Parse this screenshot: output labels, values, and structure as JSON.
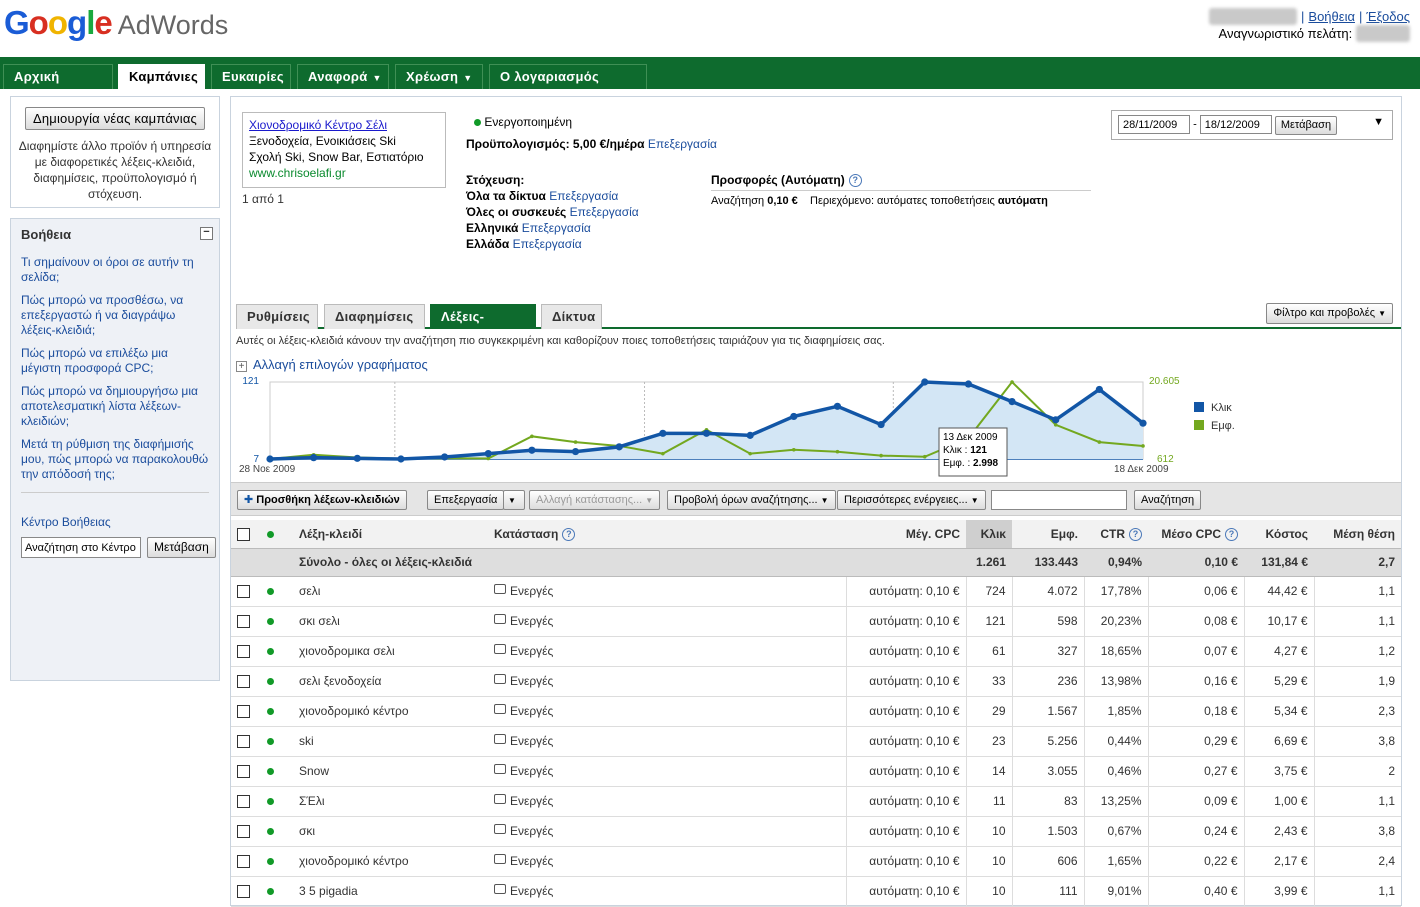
{
  "header": {
    "logo_word": "Google",
    "product": "AdWords",
    "email": "•••••••@••••••.gr",
    "help_link": "Βοήθεια",
    "logout_link": "Έξοδος",
    "customer_id_label": "Αναγνωριστικό πελάτη:",
    "customer_id": "•••-•••-••••"
  },
  "nav": {
    "tabs": [
      {
        "label": "Αρχική σελίδα"
      },
      {
        "label": "Καμπάνιες"
      },
      {
        "label": "Ευκαιρίες"
      },
      {
        "label": "Αναφορά"
      },
      {
        "label": "Χρέωση"
      },
      {
        "label": "Ο λογαριασμός μου"
      }
    ],
    "active_index": 1
  },
  "left": {
    "create_button": "Δημιουργία νέας καμπάνιας",
    "create_desc": "Διαφημίστε άλλο προϊόν ή υπηρεσία με διαφορετικές λέξεις-κλειδιά, διαφημίσεις, προϋπολογισμό ή στόχευση.",
    "help_title": "Βοήθεια",
    "help_links": [
      "Τι σημαίνουν οι όροι σε αυτήν τη σελίδα;",
      "Πώς μπορώ να προσθέσω, να επεξεργαστώ ή να διαγράψω λέξεις-κλειδιά;",
      "Πώς μπορώ να επιλέξω μια μέγιστη προσφορά CPC;",
      "Πώς μπορώ να δημιουργήσω μια αποτελεσματική λίστα λέξεων-κλειδιών;",
      "Μετά τη ρύθμιση της διαφήμισής μου, πώς μπορώ να παρακολουθώ την απόδοσή της;"
    ],
    "help_center": "Κέντρο Βοήθειας",
    "help_search_value": "Αναζήτηση στο Κέντρο Β",
    "help_search_button": "Μετάβαση"
  },
  "ad": {
    "title": "Χιονοδρομικό Κέντρο Σέλι",
    "line1": "Ξενοδοχεία, Ενοικιάσεις Ski",
    "line2": "Σχολή Ski, Snow Bar, Εστιατόριο",
    "url": "www.chrisoelafi.gr",
    "count": "1 από 1"
  },
  "campaign": {
    "status": "Ενεργοποιημένη",
    "budget_label": "Προϋπολογισμός:",
    "budget_value": "5,00 €/ημέρα",
    "edit": "Επεξεργασία",
    "targeting_label": "Στόχευση:",
    "targeting": [
      {
        "label": "Όλα τα δίκτυα"
      },
      {
        "label": "Όλες οι συσκευές"
      },
      {
        "label": "Ελληνικά"
      },
      {
        "label": "Ελλάδα"
      }
    ],
    "bids_label": "Προσφορές (Αυτόματη)",
    "search_label": "Αναζήτηση",
    "search_value": "0,10 €",
    "content_label": "Περιεχόμενο: αυτόματες τοποθετήσεις",
    "content_value": "αυτόματη"
  },
  "daterange": {
    "start": "28/11/2009",
    "dash": "-",
    "end": "18/12/2009",
    "go": "Μετάβαση"
  },
  "subtabs": [
    {
      "label": "Ρυθμίσεις"
    },
    {
      "label": "Διαφημίσεις"
    },
    {
      "label": "Λέξεις-κλειδιά"
    },
    {
      "label": "Δίκτυα"
    }
  ],
  "subtab_active": 2,
  "filter_button": "Φίλτρο και προβολές",
  "subtab_desc": "Αυτές οι λέξεις-κλειδιά κάνουν την αναζήτηση πιο συγκεκριμένη και καθορίζουν ποιες τοποθετήσεις ταιριάζουν για τις διαφημίσεις σας.",
  "chart_toggle": "Αλλαγή επιλογών γραφήματος",
  "chart_data": {
    "type": "line",
    "x_start_label": "28 Νοε 2009",
    "x_end_label": "18 Δεκ 2009",
    "series": [
      {
        "name": "Κλικ",
        "color": "#1256a6",
        "axis": "left",
        "values": [
          7,
          9,
          8,
          7,
          10,
          15,
          20,
          18,
          25,
          45,
          45,
          42,
          70,
          85,
          58,
          121,
          118,
          92,
          65,
          110,
          60
        ]
      },
      {
        "name": "Εμφ.",
        "color": "#73a81f",
        "axis": "right",
        "values": [
          612,
          1700,
          1000,
          700,
          800,
          750,
          6500,
          5000,
          4000,
          2000,
          8200,
          2000,
          3000,
          2500,
          1500,
          1200,
          6000,
          20605,
          9500,
          5000,
          4000
        ]
      }
    ],
    "left_axis": {
      "min": 7,
      "max": 121,
      "min_label": "7",
      "max_label": "121"
    },
    "right_axis": {
      "min": 612,
      "max": 20605,
      "min_label": "612",
      "max_label": "20.605"
    },
    "tooltip": {
      "date": "13 Δεκ 2009",
      "clicks_label": "Κλικ :",
      "clicks": "121",
      "impr_label": "Εμφ. :",
      "impr": "2.998",
      "index": 15
    }
  },
  "toolbar": {
    "add": "Προσθήκη λέξεων-κλειδιών",
    "edit": "Επεξεργασία",
    "status": "Αλλαγή κατάστασης...",
    "search_terms": "Προβολή όρων αναζήτησης...",
    "more": "Περισσότερες ενέργειες...",
    "search_button": "Αναζήτηση"
  },
  "table": {
    "headers": {
      "keyword": "Λέξη-κλειδί",
      "status": "Κατάσταση",
      "maxcpc": "Μέγ. CPC",
      "clicks": "Κλικ",
      "impr": "Εμφ.",
      "ctr": "CTR",
      "avgcpc": "Μέσο CPC",
      "cost": "Κόστος",
      "pos": "Μέση θέση"
    },
    "total": {
      "label": "Σύνολο - όλες οι λέξεις-κλειδιά",
      "clicks": "1.261",
      "impr": "133.443",
      "ctr": "0,94%",
      "avgcpc": "0,10 €",
      "cost": "131,84 €",
      "pos": "2,7"
    },
    "rows": [
      {
        "kw": "σελι",
        "status": "Ενεργές",
        "maxcpc": "αυτόματη: 0,10 €",
        "clicks": "724",
        "impr": "4.072",
        "ctr": "17,78%",
        "avgcpc": "0,06 €",
        "cost": "44,42 €",
        "pos": "1,1"
      },
      {
        "kw": "σκι σελι",
        "status": "Ενεργές",
        "maxcpc": "αυτόματη: 0,10 €",
        "clicks": "121",
        "impr": "598",
        "ctr": "20,23%",
        "avgcpc": "0,08 €",
        "cost": "10,17 €",
        "pos": "1,1"
      },
      {
        "kw": "χιονοδρομικα σελι",
        "status": "Ενεργές",
        "maxcpc": "αυτόματη: 0,10 €",
        "clicks": "61",
        "impr": "327",
        "ctr": "18,65%",
        "avgcpc": "0,07 €",
        "cost": "4,27 €",
        "pos": "1,2"
      },
      {
        "kw": "σελι ξενοδοχεία",
        "status": "Ενεργές",
        "maxcpc": "αυτόματη: 0,10 €",
        "clicks": "33",
        "impr": "236",
        "ctr": "13,98%",
        "avgcpc": "0,16 €",
        "cost": "5,29 €",
        "pos": "1,9"
      },
      {
        "kw": "χιονοδρομικό κέντρο",
        "status": "Ενεργές",
        "maxcpc": "αυτόματη: 0,10 €",
        "clicks": "29",
        "impr": "1.567",
        "ctr": "1,85%",
        "avgcpc": "0,18 €",
        "cost": "5,34 €",
        "pos": "2,3"
      },
      {
        "kw": "ski",
        "status": "Ενεργές",
        "maxcpc": "αυτόματη: 0,10 €",
        "clicks": "23",
        "impr": "5.256",
        "ctr": "0,44%",
        "avgcpc": "0,29 €",
        "cost": "6,69 €",
        "pos": "3,8"
      },
      {
        "kw": "Snow",
        "status": "Ενεργές",
        "maxcpc": "αυτόματη: 0,10 €",
        "clicks": "14",
        "impr": "3.055",
        "ctr": "0,46%",
        "avgcpc": "0,27 €",
        "cost": "3,75 €",
        "pos": "2"
      },
      {
        "kw": "ΣΈλι",
        "status": "Ενεργές",
        "maxcpc": "αυτόματη: 0,10 €",
        "clicks": "11",
        "impr": "83",
        "ctr": "13,25%",
        "avgcpc": "0,09 €",
        "cost": "1,00 €",
        "pos": "1,1"
      },
      {
        "kw": "σκι",
        "status": "Ενεργές",
        "maxcpc": "αυτόματη: 0,10 €",
        "clicks": "10",
        "impr": "1.503",
        "ctr": "0,67%",
        "avgcpc": "0,24 €",
        "cost": "2,43 €",
        "pos": "3,8"
      },
      {
        "kw": "χιονοδρομικό κέντρο",
        "status": "Ενεργές",
        "maxcpc": "αυτόματη: 0,10 €",
        "clicks": "10",
        "impr": "606",
        "ctr": "1,65%",
        "avgcpc": "0,22 €",
        "cost": "2,17 €",
        "pos": "2,4"
      },
      {
        "kw": "3 5 pigadia",
        "status": "Ενεργές",
        "maxcpc": "αυτόματη: 0,10 €",
        "clicks": "10",
        "impr": "111",
        "ctr": "9,01%",
        "avgcpc": "0,40 €",
        "cost": "3,99 €",
        "pos": "1,1"
      }
    ]
  },
  "colors": {
    "nav_green": "#0e6b2e",
    "link": "#1a4c9c",
    "clicks_line": "#1256a6",
    "impr_line": "#73a81f",
    "active_dot": "#119a28"
  }
}
